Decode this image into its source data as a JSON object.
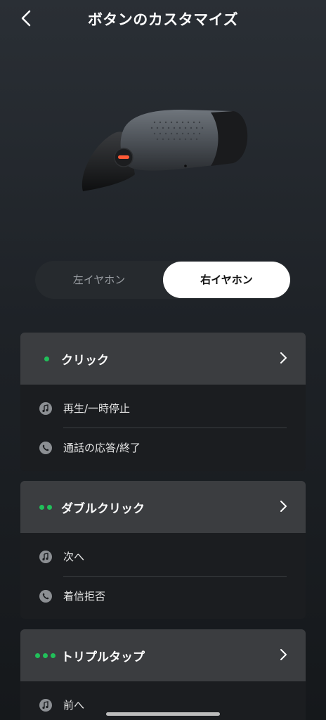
{
  "header": {
    "title": "ボタンのカスタマイズ"
  },
  "tabs": {
    "left_label": "左イヤホン",
    "right_label": "右イヤホン",
    "selected": "right"
  },
  "cards": [
    {
      "title": "クリック",
      "dots": 1,
      "items": [
        "再生/一時停止",
        "通話の応答/終了"
      ]
    },
    {
      "title": "ダブルクリック",
      "dots": 2,
      "items": [
        "次へ",
        "着信拒否"
      ]
    },
    {
      "title": "トリプルタップ",
      "dots": 3,
      "items": [
        "前へ"
      ]
    }
  ],
  "colors": {
    "accent_green": "#21c05a",
    "card_header": "#3b3d40",
    "card_body": "#1b1d20"
  }
}
